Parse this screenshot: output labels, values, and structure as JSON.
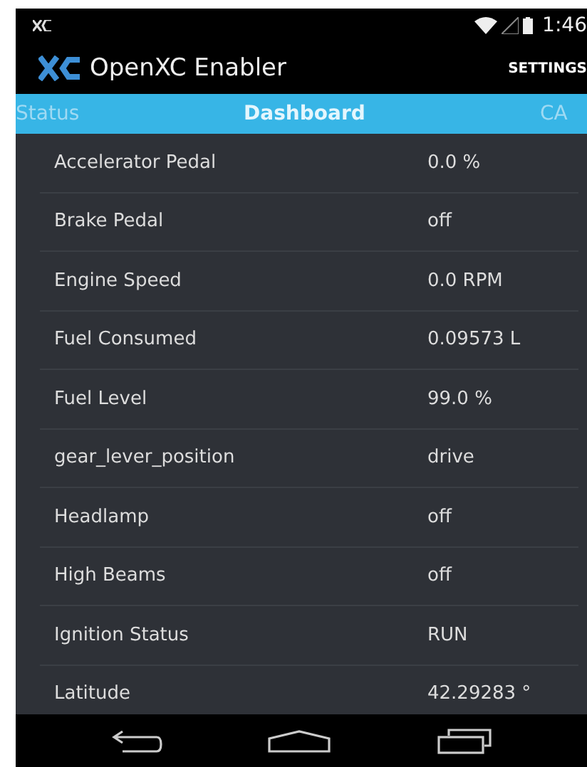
{
  "status_bar": {
    "time": "1:46"
  },
  "action_bar": {
    "title": "OpenXC Enabler",
    "action": "SETTINGS"
  },
  "tabs": [
    {
      "label": "Status",
      "selected": false
    },
    {
      "label": "Dashboard",
      "selected": true
    },
    {
      "label": "CA",
      "selected": false
    }
  ],
  "rows": [
    {
      "name": "Accelerator Pedal",
      "value": "0.0 %"
    },
    {
      "name": "Brake Pedal",
      "value": "off"
    },
    {
      "name": "Engine Speed",
      "value": "0.0 RPM"
    },
    {
      "name": "Fuel Consumed",
      "value": "0.09573 L"
    },
    {
      "name": "Fuel Level",
      "value": "99.0 %"
    },
    {
      "name": "gear_lever_position",
      "value": "drive"
    },
    {
      "name": "Headlamp",
      "value": "off"
    },
    {
      "name": "High Beams",
      "value": "off"
    },
    {
      "name": "Ignition Status",
      "value": "RUN"
    },
    {
      "name": "Latitude",
      "value": "42.29283 °"
    }
  ]
}
